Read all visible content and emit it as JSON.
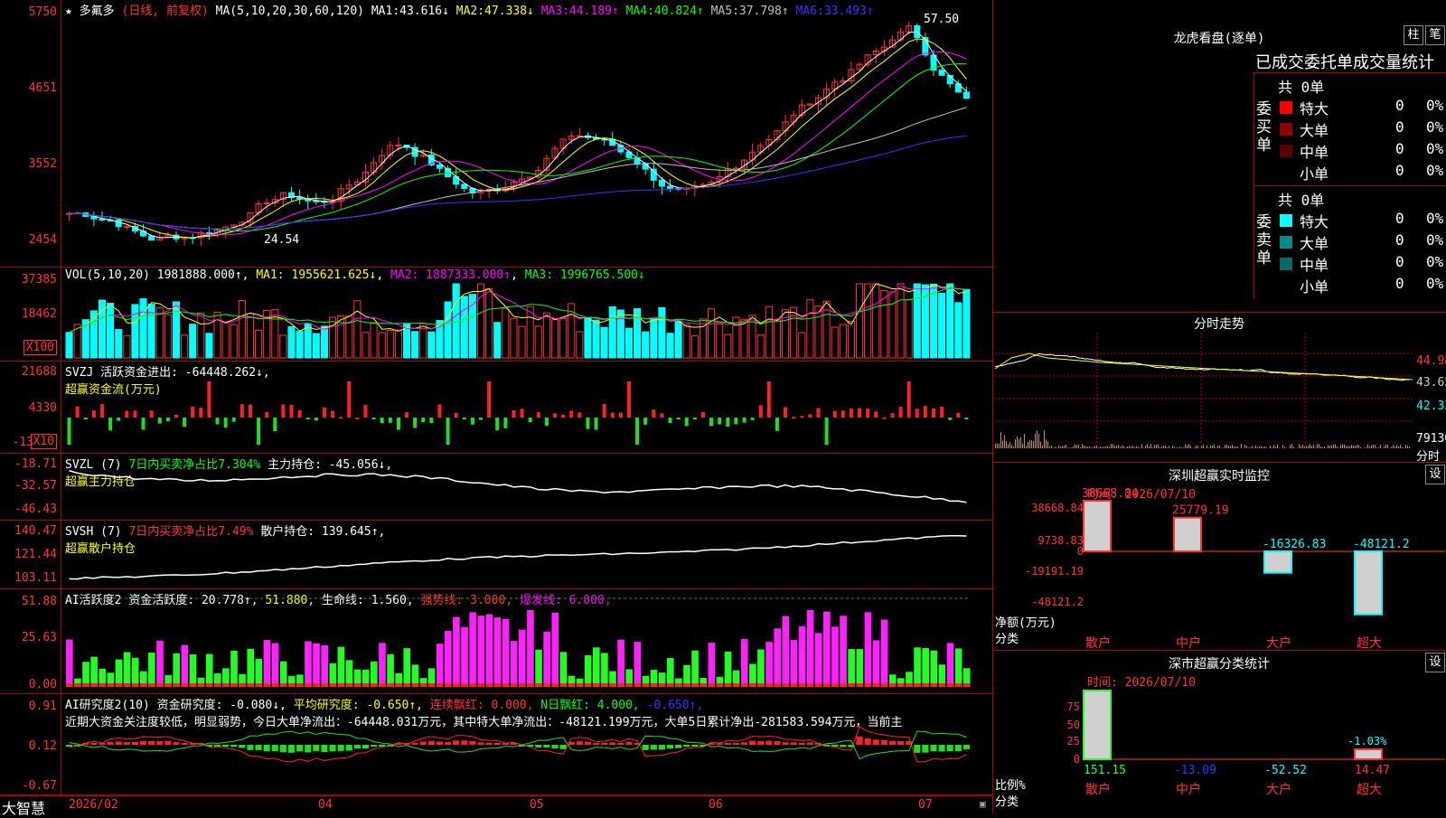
{
  "main": {
    "title": "多氟多",
    "mode": "(日线, 前复权)",
    "ma_label": "MA(5,10,20,30,60,120)",
    "ma": [
      {
        "label": "MA1:",
        "value": "43.616↓",
        "color": "#ffffff"
      },
      {
        "label": "MA2:",
        "value": "47.338↓",
        "color": "#ffff00"
      },
      {
        "label": "MA3:",
        "value": "44.189↑",
        "color": "#ff00ff"
      },
      {
        "label": "MA4:",
        "value": "40.824↑",
        "color": "#00ff00"
      },
      {
        "label": "MA5:",
        "value": "37.798↑",
        "color": "#c0c0c0"
      },
      {
        "label": "MA6:",
        "value": "33.493↑",
        "color": "#3333ff"
      }
    ],
    "ticks": [
      "5750",
      "4651",
      "3552",
      "2454"
    ],
    "high_label": "57.50",
    "low_label": "24.54"
  },
  "vol": {
    "label": "VOL(5,10,20)",
    "value": "1981888.000↑",
    "ma1": "MA1: 1955621.625↓",
    "ma2": "MA2: 1887333.000↑",
    "ma3": "MA3: 1996765.500↓",
    "ticks": [
      "37385",
      "18462"
    ],
    "unit": "X100"
  },
  "svzj": {
    "label": "SVZJ",
    "desc": "活跃资金进出: -64448.262↓,",
    "sub": "超赢资金流(万元)",
    "ticks": [
      "21688",
      "4330",
      "-13"
    ],
    "unit": "X10"
  },
  "svzl": {
    "label": "SVZL (7)",
    "desc1": "7日内买卖净占比7.304%",
    "desc2": "主力持仓: -45.056↓,",
    "sub": "超赢主力持仓",
    "ticks": [
      "-18.71",
      "-32.57",
      "-46.43"
    ]
  },
  "svsh": {
    "label": "SVSH (7)",
    "desc1": "7日内买卖净占比7.49%",
    "desc2": "散户持仓: 139.645↑,",
    "sub": "超赢散户持仓",
    "ticks": [
      "140.47",
      "121.44",
      "103.11"
    ]
  },
  "ai2": {
    "label": "AI活跃度2",
    "v1": "资金活跃度: 20.778↑,",
    "v2": "51.880,",
    "v3": "生命线: 1.560,",
    "v4": "强势线: 3.000,",
    "v5": "爆发线: 6.000,",
    "ticks": [
      "51.88",
      "25.63",
      "0.00"
    ]
  },
  "ai_research": {
    "label": "AI研究度2(10)",
    "v1": "资金研究度: -0.080↓,",
    "v2": "平均研究度: -0.650↑,",
    "v3": "连续飘红: 0.000,",
    "v4": "N日飘红: 4.000,",
    "v5": "-0.650↑,",
    "text": "近期大资金关注度较低，明显弱势，今日大单净流出：-64448.031万元，其中特大单净流出：-48121.199万元，大单5日累计净出-281583.594万元，当前主",
    "ticks": [
      "0.91",
      "0.12",
      "-0.67"
    ]
  },
  "xaxis": {
    "brand": "大智慧",
    "labels": [
      "2026/02",
      "04",
      "05",
      "06",
      "07"
    ]
  },
  "longhu": {
    "title": "龙虎看盘(逐单)",
    "btn1": "柱",
    "btn2": "笔",
    "header": "已成交委托单成交量统计",
    "buy_side": "委买单",
    "sell_side": "委卖单",
    "buy_total": "共 0单",
    "sell_total": "共 0单",
    "buy_rows": [
      {
        "name": "特大",
        "count": "0",
        "pct": "0%",
        "color": "#ff0000"
      },
      {
        "name": "大单",
        "count": "0",
        "pct": "0%",
        "color": "#8b0000"
      },
      {
        "name": "中单",
        "count": "0",
        "pct": "0%",
        "color": "#5a0000"
      },
      {
        "name": "小单",
        "count": "0",
        "pct": "0%",
        "color": ""
      }
    ],
    "sell_rows": [
      {
        "name": "特大",
        "count": "0",
        "pct": "0%",
        "color": "#00ffff"
      },
      {
        "name": "大单",
        "count": "0",
        "pct": "0%",
        "color": "#008b8b"
      },
      {
        "name": "中单",
        "count": "0",
        "pct": "0%",
        "color": "#006b6b"
      },
      {
        "name": "小单",
        "count": "0",
        "pct": "0%",
        "color": ""
      }
    ]
  },
  "intraday": {
    "title": "分时走势",
    "ticks": [
      "44.98",
      "43.65",
      "42.33"
    ],
    "vol_tick": "79136",
    "foot": "分时"
  },
  "szmon": {
    "title": "深圳超赢实时监控",
    "btn": "设",
    "time": "时间: 2026/07/10",
    "ticks": [
      "38668.84",
      "9738.83",
      "0",
      "-19191.19",
      "-48121.2"
    ],
    "unit": "净额(万元)",
    "cat_label": "分类",
    "cats": [
      "散户",
      "中户",
      "大户",
      "超大"
    ],
    "values_text": [
      "38668.84",
      "25779.19",
      "-16326.83",
      "-48121.2"
    ]
  },
  "szcls": {
    "title": "深市超赢分类统计",
    "btn": "设",
    "time": "时间: 2026/07/10",
    "ticks": [
      "75",
      "50",
      "25",
      "0"
    ],
    "ratio_label": "比例%",
    "cat_label": "分类",
    "cats": [
      "散户",
      "中户",
      "大户",
      "超大"
    ],
    "values_text": [
      "151.15",
      "-13.09",
      "-52.52",
      "14.47"
    ],
    "extra": "-1.03%"
  },
  "chart_data": [
    {
      "type": "line",
      "title": "多氟多",
      "x_range": [
        "2026/02",
        "2026/07"
      ],
      "ylim": [
        24.54,
        57.5
      ],
      "series": [
        {
          "name": "MA1",
          "last": 43.616
        },
        {
          "name": "MA2",
          "last": 47.338
        },
        {
          "name": "MA3",
          "last": 44.189
        },
        {
          "name": "MA4",
          "last": 40.824
        },
        {
          "name": "MA5",
          "last": 37.798
        },
        {
          "name": "MA6",
          "last": 33.493
        }
      ]
    },
    {
      "type": "bar",
      "title": "超赢实时监控",
      "categories": [
        "散户",
        "中户",
        "大户",
        "超大"
      ],
      "values": [
        38668.84,
        25779.19,
        -16326.83,
        -48121.2
      ],
      "ylabel": "净额(万元)"
    },
    {
      "type": "bar",
      "title": "超赢分类统计",
      "categories": [
        "散户",
        "中户",
        "大户",
        "超大"
      ],
      "values": [
        151.15,
        -13.09,
        -52.52,
        14.47
      ],
      "ylabel": "比例%"
    }
  ]
}
